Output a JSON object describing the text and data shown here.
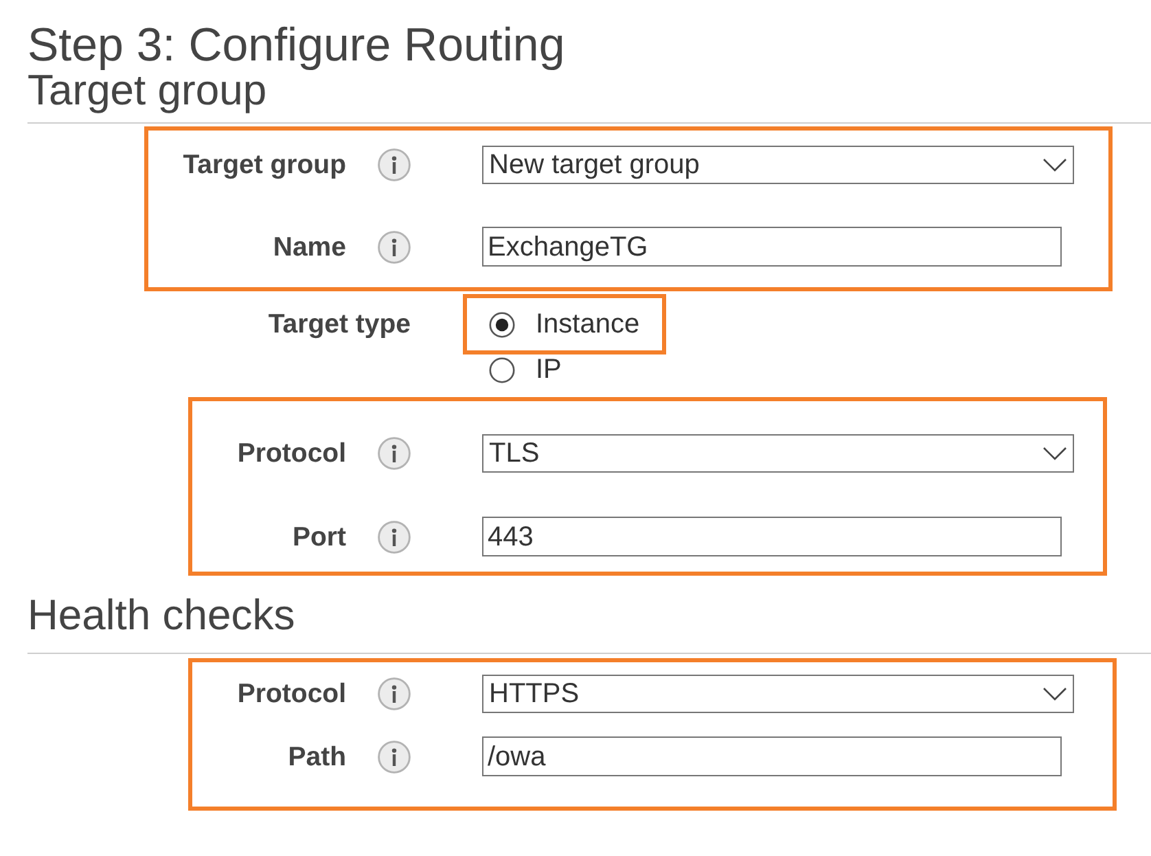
{
  "title": "Step 3: Configure Routing",
  "sections": [
    {
      "heading": "Target group",
      "blocks": [
        {
          "kind": "fields",
          "highlighted": true,
          "fields": [
            {
              "kind": "select",
              "label": "Target group",
              "value": "New target group"
            },
            {
              "kind": "input",
              "label": "Name",
              "value": "ExchangeTG"
            }
          ]
        },
        {
          "kind": "radio",
          "label": "Target type",
          "options": [
            {
              "label": "Instance",
              "selected": true,
              "highlighted": true
            },
            {
              "label": "IP",
              "selected": false,
              "highlighted": false
            }
          ]
        },
        {
          "kind": "fields",
          "highlighted": true,
          "fields": [
            {
              "kind": "select",
              "label": "Protocol",
              "value": "TLS"
            },
            {
              "kind": "input",
              "label": "Port",
              "value": "443"
            }
          ]
        }
      ]
    },
    {
      "heading": "Health checks",
      "blocks": [
        {
          "kind": "fields",
          "highlighted": true,
          "fields": [
            {
              "kind": "select",
              "label": "Protocol",
              "value": "HTTPS"
            },
            {
              "kind": "input",
              "label": "Path",
              "value": "/owa"
            }
          ]
        }
      ]
    }
  ]
}
